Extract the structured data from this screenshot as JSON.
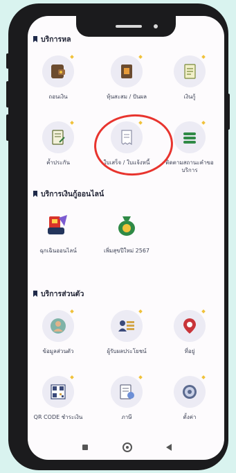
{
  "colors": {
    "background": "#d9f3ef",
    "screen": "#fdfbfd",
    "icon_circle": "#ecebf4",
    "highlight": "#e8342e"
  },
  "sections": [
    {
      "title": "บริการหล",
      "tiles": [
        {
          "label": "ถอนเงิน",
          "icon": "wallet-icon"
        },
        {
          "label": "หุ้นสะสม / ปันผล",
          "icon": "book-icon"
        },
        {
          "label": "เงินกู้",
          "icon": "document-icon"
        },
        {
          "label": "ค้ำประกัน",
          "icon": "contract-icon"
        },
        {
          "label": "ใบเสร็จ / ใบแจ้งหนี้",
          "icon": "receipt-icon"
        },
        {
          "label": "ติดตามสถานะคำขอบริการ",
          "icon": "stack-icon"
        }
      ]
    },
    {
      "title": "บริการเงินกู้ออนไลน์",
      "tiles": [
        {
          "label": "ฉุกเฉินออนไลน์",
          "icon": "emergency-loan-icon"
        },
        {
          "label": "เพิ่มสุขปีใหม่ 2567",
          "icon": "money-bag-icon"
        }
      ]
    },
    {
      "title": "บริการส่วนตัว",
      "tiles": [
        {
          "label": "ข้อมูลส่วนตัว",
          "icon": "user-icon"
        },
        {
          "label": "ผู้รับผลประโยชน์",
          "icon": "beneficiary-icon"
        },
        {
          "label": "ที่อยู่",
          "icon": "location-icon"
        },
        {
          "label": "QR CODE ชำระเงิน",
          "icon": "qr-code-icon"
        },
        {
          "label": "ภาษี",
          "icon": "tax-icon"
        },
        {
          "label": "ตั้งค่า",
          "icon": "settings-icon"
        }
      ]
    }
  ],
  "navigation": {
    "recent": "recent-apps-icon",
    "home": "home-icon",
    "back": "back-icon"
  }
}
